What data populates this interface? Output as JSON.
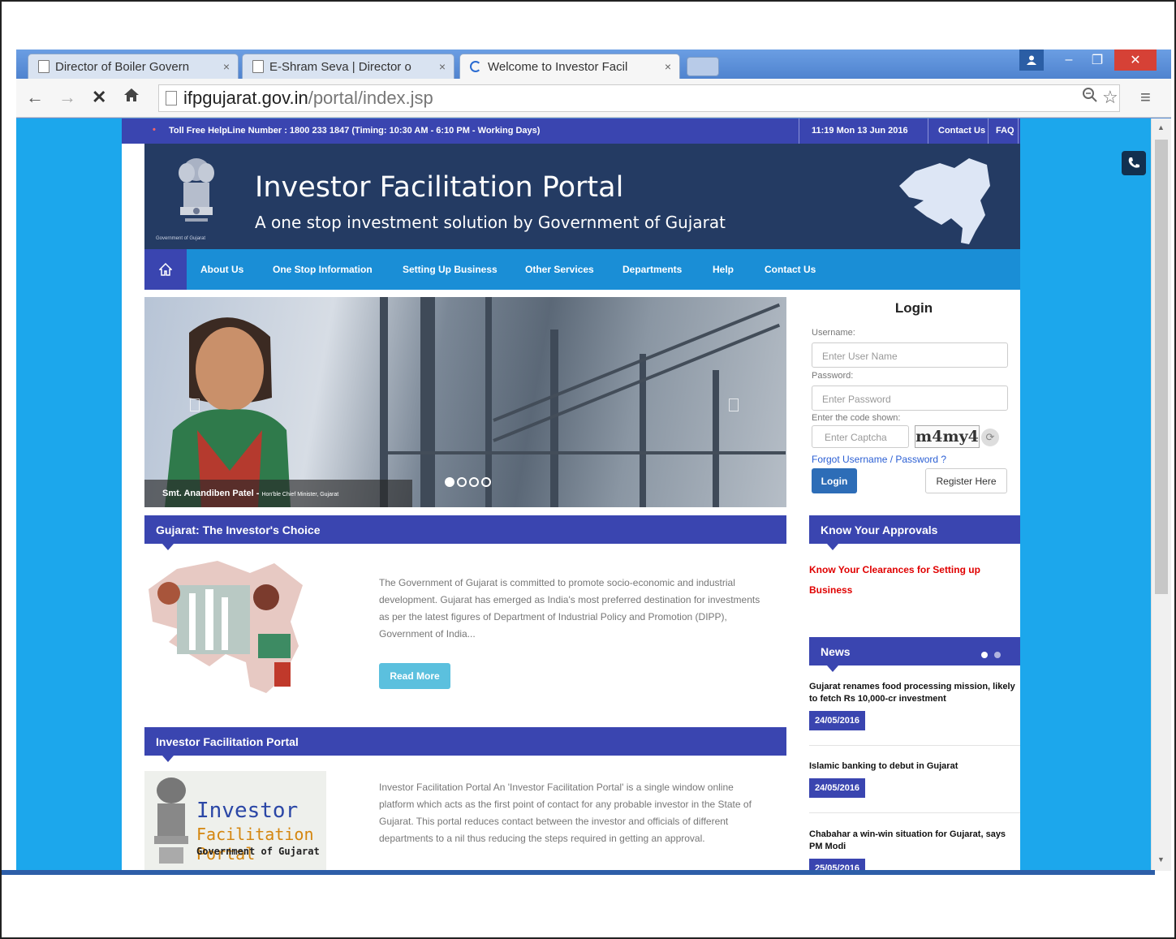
{
  "browser": {
    "tabs": [
      {
        "label": "Director of Boiler Govern",
        "state": "inactive"
      },
      {
        "label": "E-Shram Seva | Director o",
        "state": "inactive"
      },
      {
        "label": "Welcome to Investor Facil",
        "state": "active-loading"
      }
    ],
    "tab_close": "×",
    "url_host": "ifpgujarat.gov.in",
    "url_path": "/portal/index.jsp"
  },
  "site": {
    "helpline": "Toll Free HelpLine Number : 1800 233 1847 (Timing: 10:30 AM - 6:10 PM - Working Days)",
    "datetime": "11:19  Mon  13 Jun 2016",
    "top_links": [
      "Contact Us",
      "FAQ"
    ],
    "title": "Investor Facilitation Portal",
    "subtitle": "A one stop investment solution by Government of Gujarat",
    "emblem_caption": "Government of Gujarat",
    "nav": [
      "About Us",
      "One Stop Information",
      "Setting Up Business",
      "Other Services",
      "Departments",
      "Help",
      "Contact Us"
    ],
    "slider": {
      "caption_name": "Smt. Anandiben Patel - ",
      "caption_role": "Hon'ble Chief Minister, Gujarat",
      "active_slide": 1,
      "slide_count": 4
    },
    "login": {
      "heading": "Login",
      "username_label": "Username:",
      "username_placeholder": "Enter User Name",
      "password_label": "Password:",
      "password_placeholder": "Enter Password",
      "captcha_label": "Enter the code shown:",
      "captcha_placeholder": "Enter Captcha",
      "captcha_code": "m4my4",
      "forgot": "Forgot Username / Password ?",
      "login_button": "Login",
      "register_button": "Register Here"
    },
    "section1": {
      "heading": "Gujarat: The Investor's Choice",
      "text": "The Government of Gujarat is committed to promote socio-economic and industrial development. Gujarat has emerged as India's most preferred destination for investments as per the latest figures of Department of Industrial Policy and Promotion (DIPP), Government of India...",
      "read_more": "Read More"
    },
    "section2": {
      "heading": "Investor Facilitation Portal",
      "text": "Investor Facilitation Portal An 'Investor Facilitation Portal' is a single window online platform which acts as the first point of contact for any probable investor in the State of Gujarat. This portal reduces contact between the investor and officials of different departments to a nil thus reducing the steps required in getting an approval.",
      "logo_line1": "Investor",
      "logo_line2": "Facilitation Portal",
      "logo_line3": "Government of Gujarat"
    },
    "approvals": {
      "heading": "Know Your Approvals",
      "link": "Know Your Clearances for Setting up Business"
    },
    "news": {
      "heading": "News",
      "items": [
        {
          "title": "Gujarat renames food processing mission, likely to fetch Rs 10,000-cr investment",
          "date": "24/05/2016"
        },
        {
          "title": "Islamic banking to debut in Gujarat",
          "date": "24/05/2016"
        },
        {
          "title": "Chabahar a win-win situation for Gujarat, says PM Modi",
          "date": "25/05/2016"
        }
      ]
    }
  },
  "colors": {
    "primary": "#3a45b0",
    "nav_blue": "#1a8ed6",
    "banner": "#243b63",
    "page_bg": "#1ca7ec",
    "alert_red": "#e00000"
  }
}
